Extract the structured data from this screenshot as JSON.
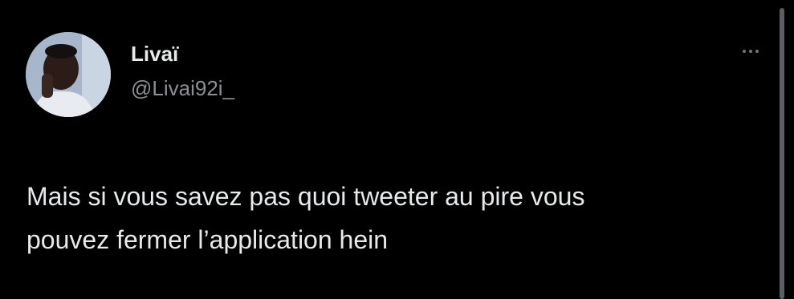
{
  "tweet": {
    "author": {
      "display_name": "Livaï",
      "handle": "@Livai92i_"
    },
    "text_lines": [
      "Mais si vous savez pas quoi tweeter au pire vous",
      "pouvez fermer l’application hein"
    ],
    "more_icon": "ellipsis-icon"
  },
  "colors": {
    "background": "#000000",
    "primary_text": "#e7e9ea",
    "secondary_text": "#8b8f94",
    "scrollbar": "#5c5f63"
  }
}
